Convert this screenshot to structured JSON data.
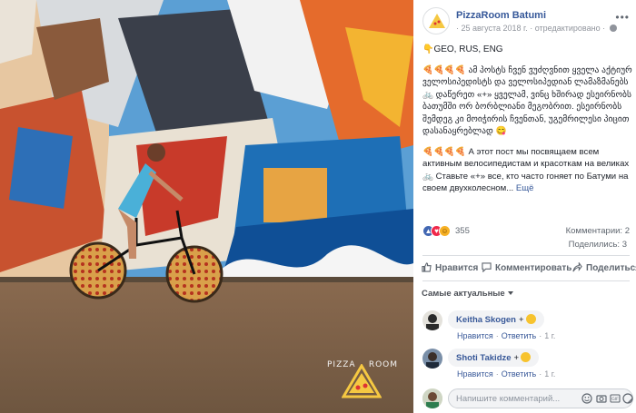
{
  "photo": {
    "watermark_left": "PIZZA",
    "watermark_right": "ROOM"
  },
  "post": {
    "page_name": "PizzaRoom Batumi",
    "meta": "· 25 августа 2018 г. · отредактировано ·",
    "flags_line": "👇GEO, RUS, ENG",
    "text_georgian": "🍕🍕🍕🍕 ამ პოსტს ჩვენ ვუძღვნით ყველა აქტიურ ველოსიპედისტს და ველოსიპედიან ლამაზმანებს 🚲 დაწერეთ «+» ყველამ, ვინც ხშირად ესეირნობს ბათუმში ორ ბორბლიანი მეგობრით. ესეირნობს შემდეგ კი მოიჭირის ჩვენთან, უგემრილესი პიცით დასანაყრებლად 😋",
    "text_russian": "🍕🍕🍕🍕 А этот пост мы посвящаем всем активным велосипедистам и красоткам на великах 🚲 Ставьте «+» все, кто часто гоняет по Батуми на своем двухколесном...",
    "see_more": "Ещё"
  },
  "stats": {
    "reactions_count": "355",
    "comments": "Комментарии: 2",
    "shares": "Поделились: 3"
  },
  "actions": {
    "like": "Нравится",
    "comment": "Комментировать",
    "share": "Поделиться"
  },
  "sort_label": "Самые актуальные",
  "comments": [
    {
      "author": "Keitha Skogen",
      "text": "+",
      "like": "Нравится",
      "reply": "Ответить",
      "time": "1 г."
    },
    {
      "author": "Shoti Takidze",
      "text": "+",
      "like": "Нравится",
      "reply": "Ответить",
      "time": "1 г."
    }
  ],
  "composer": {
    "placeholder": "Напишите комментарий..."
  },
  "colors": {
    "link": "#365899",
    "like": "#4267b2",
    "love": "#f0284a",
    "haha": "#f7b125"
  },
  "icons": [
    "more-icon",
    "globe-icon",
    "like-icon",
    "comment-icon",
    "share-icon",
    "emoji-icon",
    "camera-icon",
    "gif-icon",
    "sticker-icon"
  ]
}
